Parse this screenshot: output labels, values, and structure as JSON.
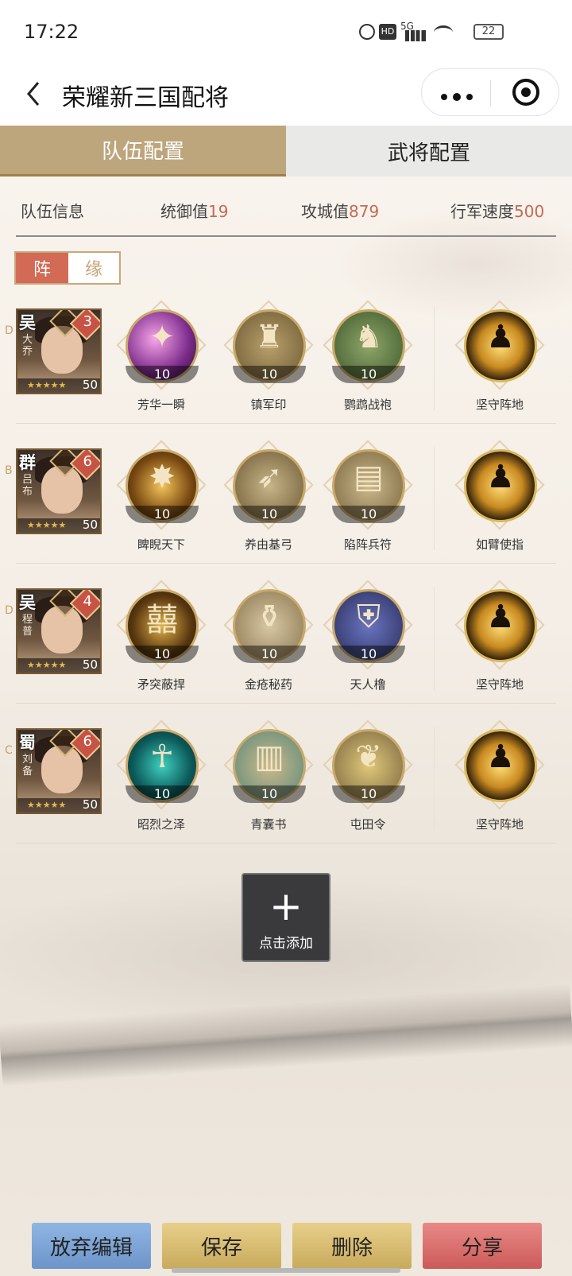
{
  "status_bar": {
    "time": "17:22",
    "network": "5G",
    "hd": "HD",
    "battery": "22"
  },
  "nav": {
    "title": "荣耀新三国配将"
  },
  "tabs": [
    {
      "label": "队伍配置",
      "active": true
    },
    {
      "label": "武将配置",
      "active": false
    }
  ],
  "team_info": {
    "label": "队伍信息",
    "command_label": "统御值",
    "command_value": "19",
    "siege_label": "攻城值",
    "siege_value": "879",
    "speed_label": "行军速度",
    "speed_value": "500"
  },
  "toggle": {
    "formation": "阵",
    "bond": "缘"
  },
  "rows": [
    {
      "hero": {
        "faction": "吴",
        "name": "大乔",
        "grade": "D",
        "badge": "3",
        "level": "50",
        "stars": "★★★★★"
      },
      "items": [
        {
          "name": "芳华一瞬",
          "level": "10",
          "icon": "pink-sparkle-icon"
        },
        {
          "name": "镇军印",
          "level": "10",
          "icon": "seal-icon"
        },
        {
          "name": "鹦鹉战袍",
          "level": "10",
          "icon": "armor-icon"
        }
      ],
      "skill": {
        "name": "坚守阵地",
        "icon": "soldier-spear-icon"
      }
    },
    {
      "hero": {
        "faction": "群",
        "name": "吕布",
        "grade": "B",
        "badge": "6",
        "level": "50",
        "stars": "★★★★★"
      },
      "items": [
        {
          "name": "睥睨天下",
          "level": "10",
          "icon": "warrior-glow-icon"
        },
        {
          "name": "养由基弓",
          "level": "10",
          "icon": "bow-icon"
        },
        {
          "name": "陷阵兵符",
          "level": "10",
          "icon": "tally-icon"
        }
      ],
      "skill": {
        "name": "如臂使指",
        "icon": "soldier-spear-icon"
      }
    },
    {
      "hero": {
        "faction": "吴",
        "name": "程普",
        "grade": "D",
        "badge": "4",
        "level": "50",
        "stars": "★★★★★"
      },
      "items": [
        {
          "name": "矛突蔽捍",
          "level": "10",
          "icon": "coin-glyph-icon"
        },
        {
          "name": "金疮秘药",
          "level": "10",
          "icon": "vase-icon"
        },
        {
          "name": "天人橹",
          "level": "10",
          "icon": "shield-icon"
        }
      ],
      "skill": {
        "name": "坚守阵地",
        "icon": "soldier-spear-icon"
      }
    },
    {
      "hero": {
        "faction": "蜀",
        "name": "刘备",
        "grade": "C",
        "badge": "6",
        "level": "50",
        "stars": "★★★★★"
      },
      "items": [
        {
          "name": "昭烈之泽",
          "level": "10",
          "icon": "teal-figure-icon"
        },
        {
          "name": "青囊书",
          "level": "10",
          "icon": "book-icon"
        },
        {
          "name": "屯田令",
          "level": "10",
          "icon": "wheat-scroll-icon"
        }
      ],
      "skill": {
        "name": "坚守阵地",
        "icon": "soldier-spear-icon"
      }
    }
  ],
  "add": {
    "label": "点击添加"
  },
  "bottom": {
    "abandon": "放弃编辑",
    "save": "保存",
    "delete": "删除",
    "share": "分享"
  },
  "colors": {
    "tab_active": "#bda57c",
    "accent_value": "#c56a54",
    "abandon_btn": "#7fa6d6",
    "save_btn": "#d9bd6e",
    "delete_btn": "#d9bd6e",
    "share_btn": "#d86868"
  }
}
